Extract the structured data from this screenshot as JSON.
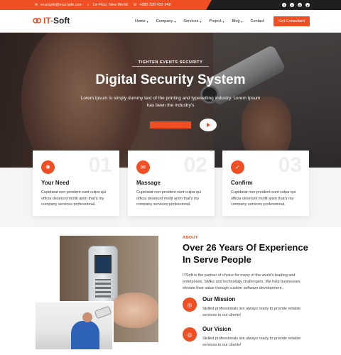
{
  "topbar": {
    "email": "example@example.com",
    "address": "1st Floor New World.",
    "phone": "+880 320 432 242",
    "social": [
      "facebook-icon",
      "twitter-icon",
      "instagram-icon",
      "pinterest-icon"
    ]
  },
  "header": {
    "logo": {
      "it": "IT-",
      "soft": "Soft"
    },
    "nav": [
      {
        "label": "Home",
        "dropdown": true
      },
      {
        "label": "Company",
        "dropdown": true
      },
      {
        "label": "Services",
        "dropdown": true
      },
      {
        "label": "Project",
        "dropdown": true
      },
      {
        "label": "Blog",
        "dropdown": true
      },
      {
        "label": "Contact",
        "dropdown": false
      }
    ],
    "cta": "Get Consultant"
  },
  "hero": {
    "subtitle": "TIGHTEN EVENTS SECURITY",
    "title": "Digital Security System",
    "text": "Lorem Ipsum is simply dummy text of the printing and typesetting industry. Lorem Ipsum has been the industry's"
  },
  "cards": [
    {
      "num": "01",
      "title": "Your Need",
      "icon": "target-icon",
      "text": "Cupidatat non proident sunt culpa qui officia deserunt mollit anim that's my company services professional."
    },
    {
      "num": "02",
      "title": "Massage",
      "icon": "message-icon",
      "text": "Cupidatat non proident sunt culpa qui officia deserunt mollit anim that's my company services professional."
    },
    {
      "num": "03",
      "title": "Confirm",
      "icon": "check-icon",
      "text": "Cupidatat non proident sunt culpa qui officia deserunt mollit anim that's my company services professional."
    }
  ],
  "about": {
    "label": "ABOUT",
    "title": "Over 26 Years Of Experience In Serve People",
    "text": "ITSoft is the partner of choice for many of the world's leading and enterprises, SMEs and technology challengers. We help businesses elevate their value through custom software development.",
    "features": [
      {
        "title": "Our Mission",
        "text": "Skilled professionals are always ready to provide reliable services to our clients!"
      },
      {
        "title": "Our Vision",
        "text": "Skilled professionals are always ready to provide reliable services to our clients!"
      }
    ]
  },
  "colors": {
    "accent": "#f04e23",
    "dark": "#1f1f1f"
  }
}
